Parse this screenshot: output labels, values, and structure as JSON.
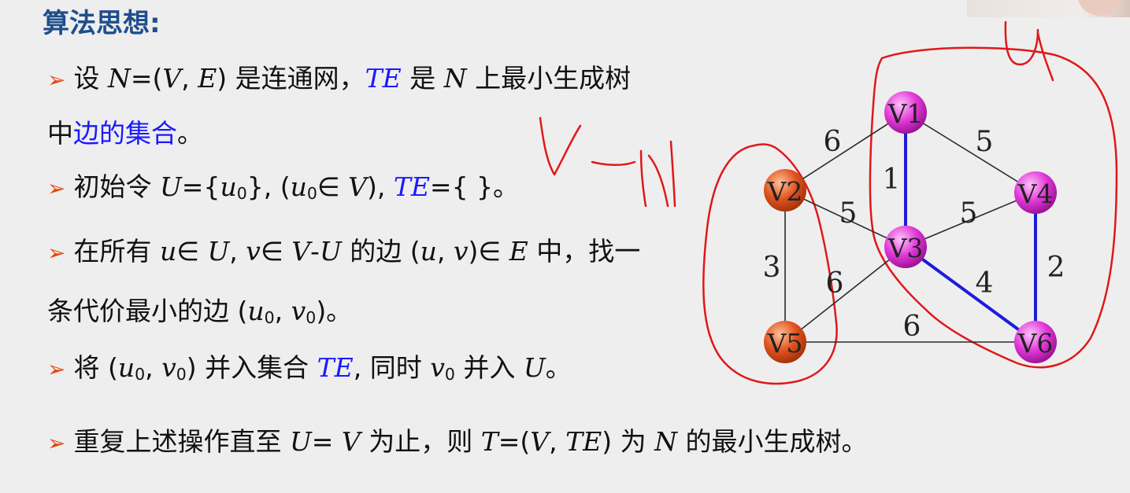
{
  "title": "算法思想:",
  "bullet_glyph": "➢",
  "lines": {
    "l1": {
      "a": "设 ",
      "b": "N",
      "c": "=(",
      "d": "V",
      "e": ", ",
      "f": "E",
      "g": ") 是连通网，",
      "h": "TE",
      "i": " 是 ",
      "j": "N",
      "k": " 上最小生成树"
    },
    "l2": {
      "a": "中",
      "b": "边的集合",
      "c": "。"
    },
    "l3": {
      "a": "初始令 ",
      "b": "U",
      "c": "={",
      "d": "u",
      "e": "0",
      "f": "}, (",
      "g": "u",
      "h": "0",
      "i": "∈ ",
      "j": "V",
      "k": "), ",
      "l": "TE",
      "m": "={ }。"
    },
    "l4": {
      "a": "在所有 ",
      "b": "u",
      "c": "∈ ",
      "d": "U",
      "e": ", ",
      "f": "v",
      "g": "∈ ",
      "h": "V",
      "i": "-",
      "j": "U",
      "k": " 的边 (",
      "l": "u",
      "m": ", ",
      "n": "v",
      "o": ")∈ ",
      "p": "E",
      "q": " 中，找一"
    },
    "l5": {
      "a": "条代价最小的边 (",
      "b": "u",
      "c": "0",
      "d": ", ",
      "e": "v",
      "f": "0",
      "g": ")。"
    },
    "l6": {
      "a": "将 (",
      "b": "u",
      "c": "0",
      "d": ", ",
      "e": "v",
      "f": "0",
      "g": ") 并入集合 ",
      "h": "TE",
      "i": ", 同时 ",
      "j": "v",
      "k": "0",
      "l": " 并入 ",
      "m": "U",
      "n": "。"
    },
    "l7": {
      "a": "重复上述操作直至 ",
      "b": "U",
      "c": "= ",
      "d": "V",
      "e": " 为止，则 ",
      "f": "T",
      "g": "=(",
      "h": "V",
      "i": ", ",
      "j": "TE",
      "k": ") 为 ",
      "l": "N",
      "m": " 的最小生成树。"
    }
  },
  "graph": {
    "vertices": [
      "V1",
      "V2",
      "V3",
      "V4",
      "V5",
      "V6"
    ],
    "edge_weights": {
      "V1_V2": "6",
      "V1_V3": "1",
      "V1_V4": "5",
      "V2_V3": "5",
      "V2_V5": "3",
      "V3_V4": "5",
      "V3_V5": "6",
      "V3_V6": "4",
      "V4_V6": "2",
      "V5_V6": "6"
    },
    "colors": {
      "selected_vertex": "#e23ad8",
      "unselected_vertex": "#e0531f",
      "tree_edge": "#1c1cd8",
      "ink": "#e01818"
    }
  },
  "handwriting": {
    "top_right": "U",
    "middle": "V-U"
  }
}
